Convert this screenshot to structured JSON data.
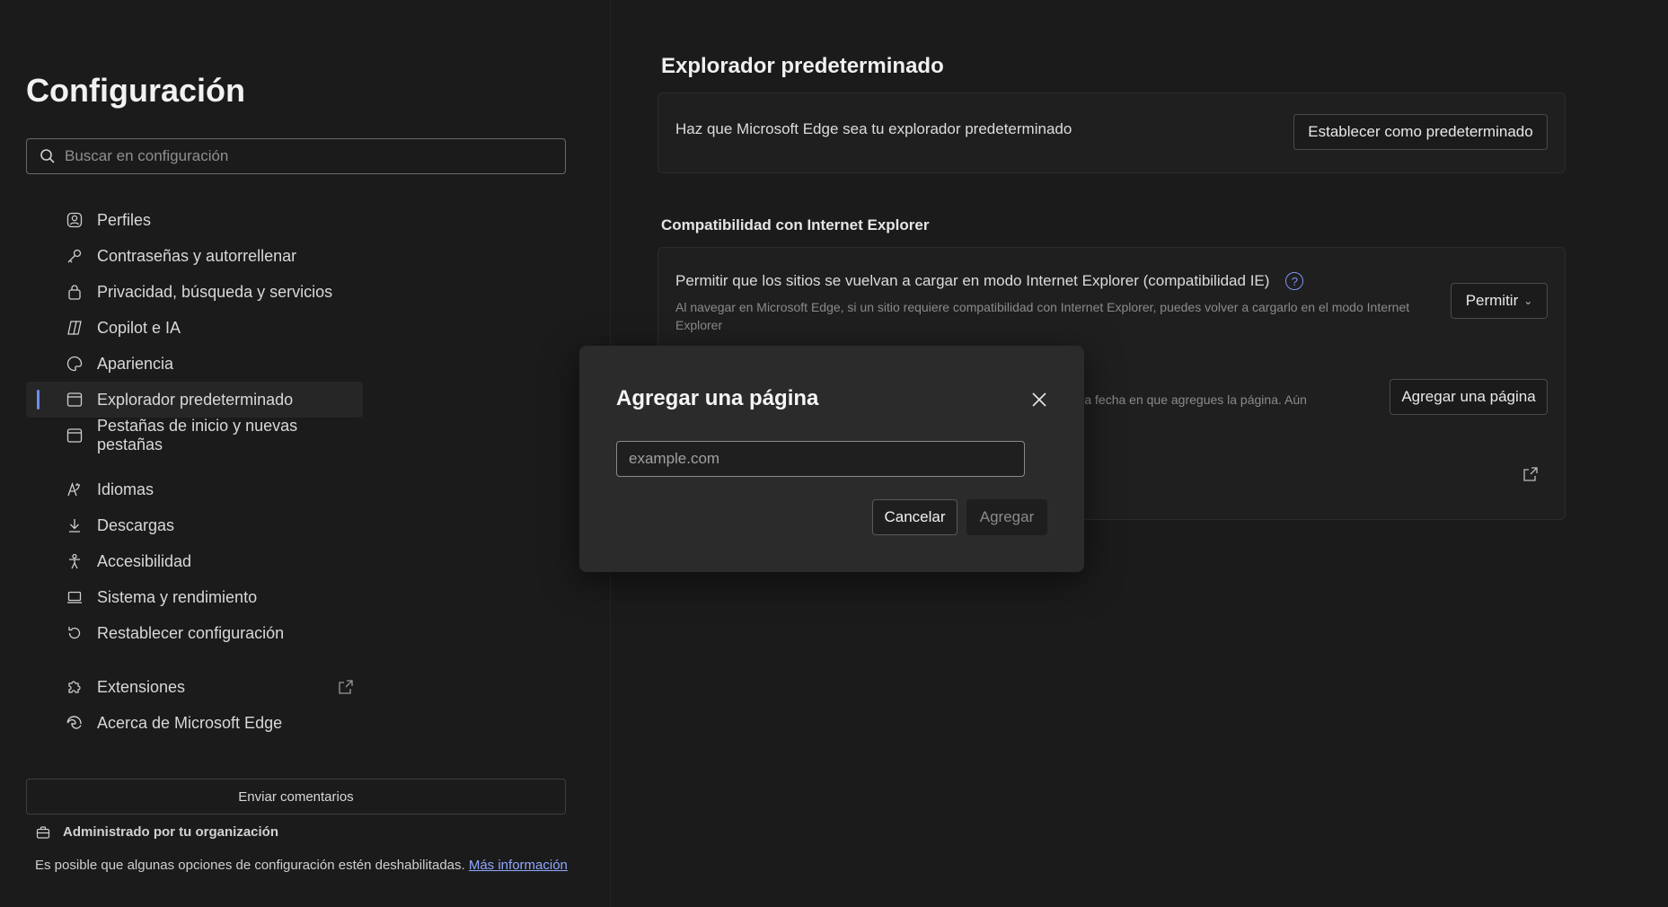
{
  "sidebar": {
    "title": "Configuración",
    "search_placeholder": "Buscar en configuración",
    "items": [
      {
        "label": "Perfiles",
        "icon": "profile-icon"
      },
      {
        "label": "Contraseñas y autorrellenar",
        "icon": "key-icon"
      },
      {
        "label": "Privacidad, búsqueda y servicios",
        "icon": "lock-icon"
      },
      {
        "label": "Copilot e IA",
        "icon": "copilot-icon"
      },
      {
        "label": "Apariencia",
        "icon": "palette-icon"
      },
      {
        "label": "Explorador predeterminado",
        "icon": "browser-icon",
        "active": true
      },
      {
        "label": "Pestañas de inicio y nuevas pestañas",
        "icon": "tabs-icon"
      },
      {
        "label": "Idiomas",
        "icon": "language-icon"
      },
      {
        "label": "Descargas",
        "icon": "download-icon"
      },
      {
        "label": "Accesibilidad",
        "icon": "accessibility-icon"
      },
      {
        "label": "Sistema y rendimiento",
        "icon": "laptop-icon"
      },
      {
        "label": "Restablecer configuración",
        "icon": "reset-icon"
      },
      {
        "label": "Extensiones",
        "icon": "puzzle-icon"
      },
      {
        "label": "Acerca de Microsoft Edge",
        "icon": "edge-icon"
      }
    ],
    "feedback_label": "Enviar comentarios",
    "managed_label": "Administrado por tu organización",
    "managed_note": "Es posible que algunas opciones de configuración estén deshabilitadas.",
    "managed_link": "Más información"
  },
  "main": {
    "section_title": "Explorador predeterminado",
    "default_text": "Haz que Microsoft Edge sea tu explorador predeterminado",
    "default_button": "Establecer como predeterminado",
    "ie_title": "Compatibilidad con Internet Explorer",
    "ie_reload_title": "Permitir que los sitios se vuelvan a cargar en modo Internet Explorer (compatibilidad IE)",
    "ie_reload_desc": "Al navegar en Microsoft Edge, si un sitio requiere compatibilidad con Internet Explorer, puedes volver a cargarlo en el modo Internet Explorer",
    "ie_reload_value": "Permitir",
    "ie_pages_desc_partial": "partir de la fecha en que agregues la página. Aún",
    "ie_pages_button": "Agregar una página"
  },
  "dialog": {
    "title": "Agregar una página",
    "input_placeholder": "example.com",
    "cancel_label": "Cancelar",
    "add_label": "Agregar"
  },
  "colors": {
    "background": "#1b1b1b",
    "accent": "#6e8cf5",
    "dialog": "#2b2b2b"
  }
}
